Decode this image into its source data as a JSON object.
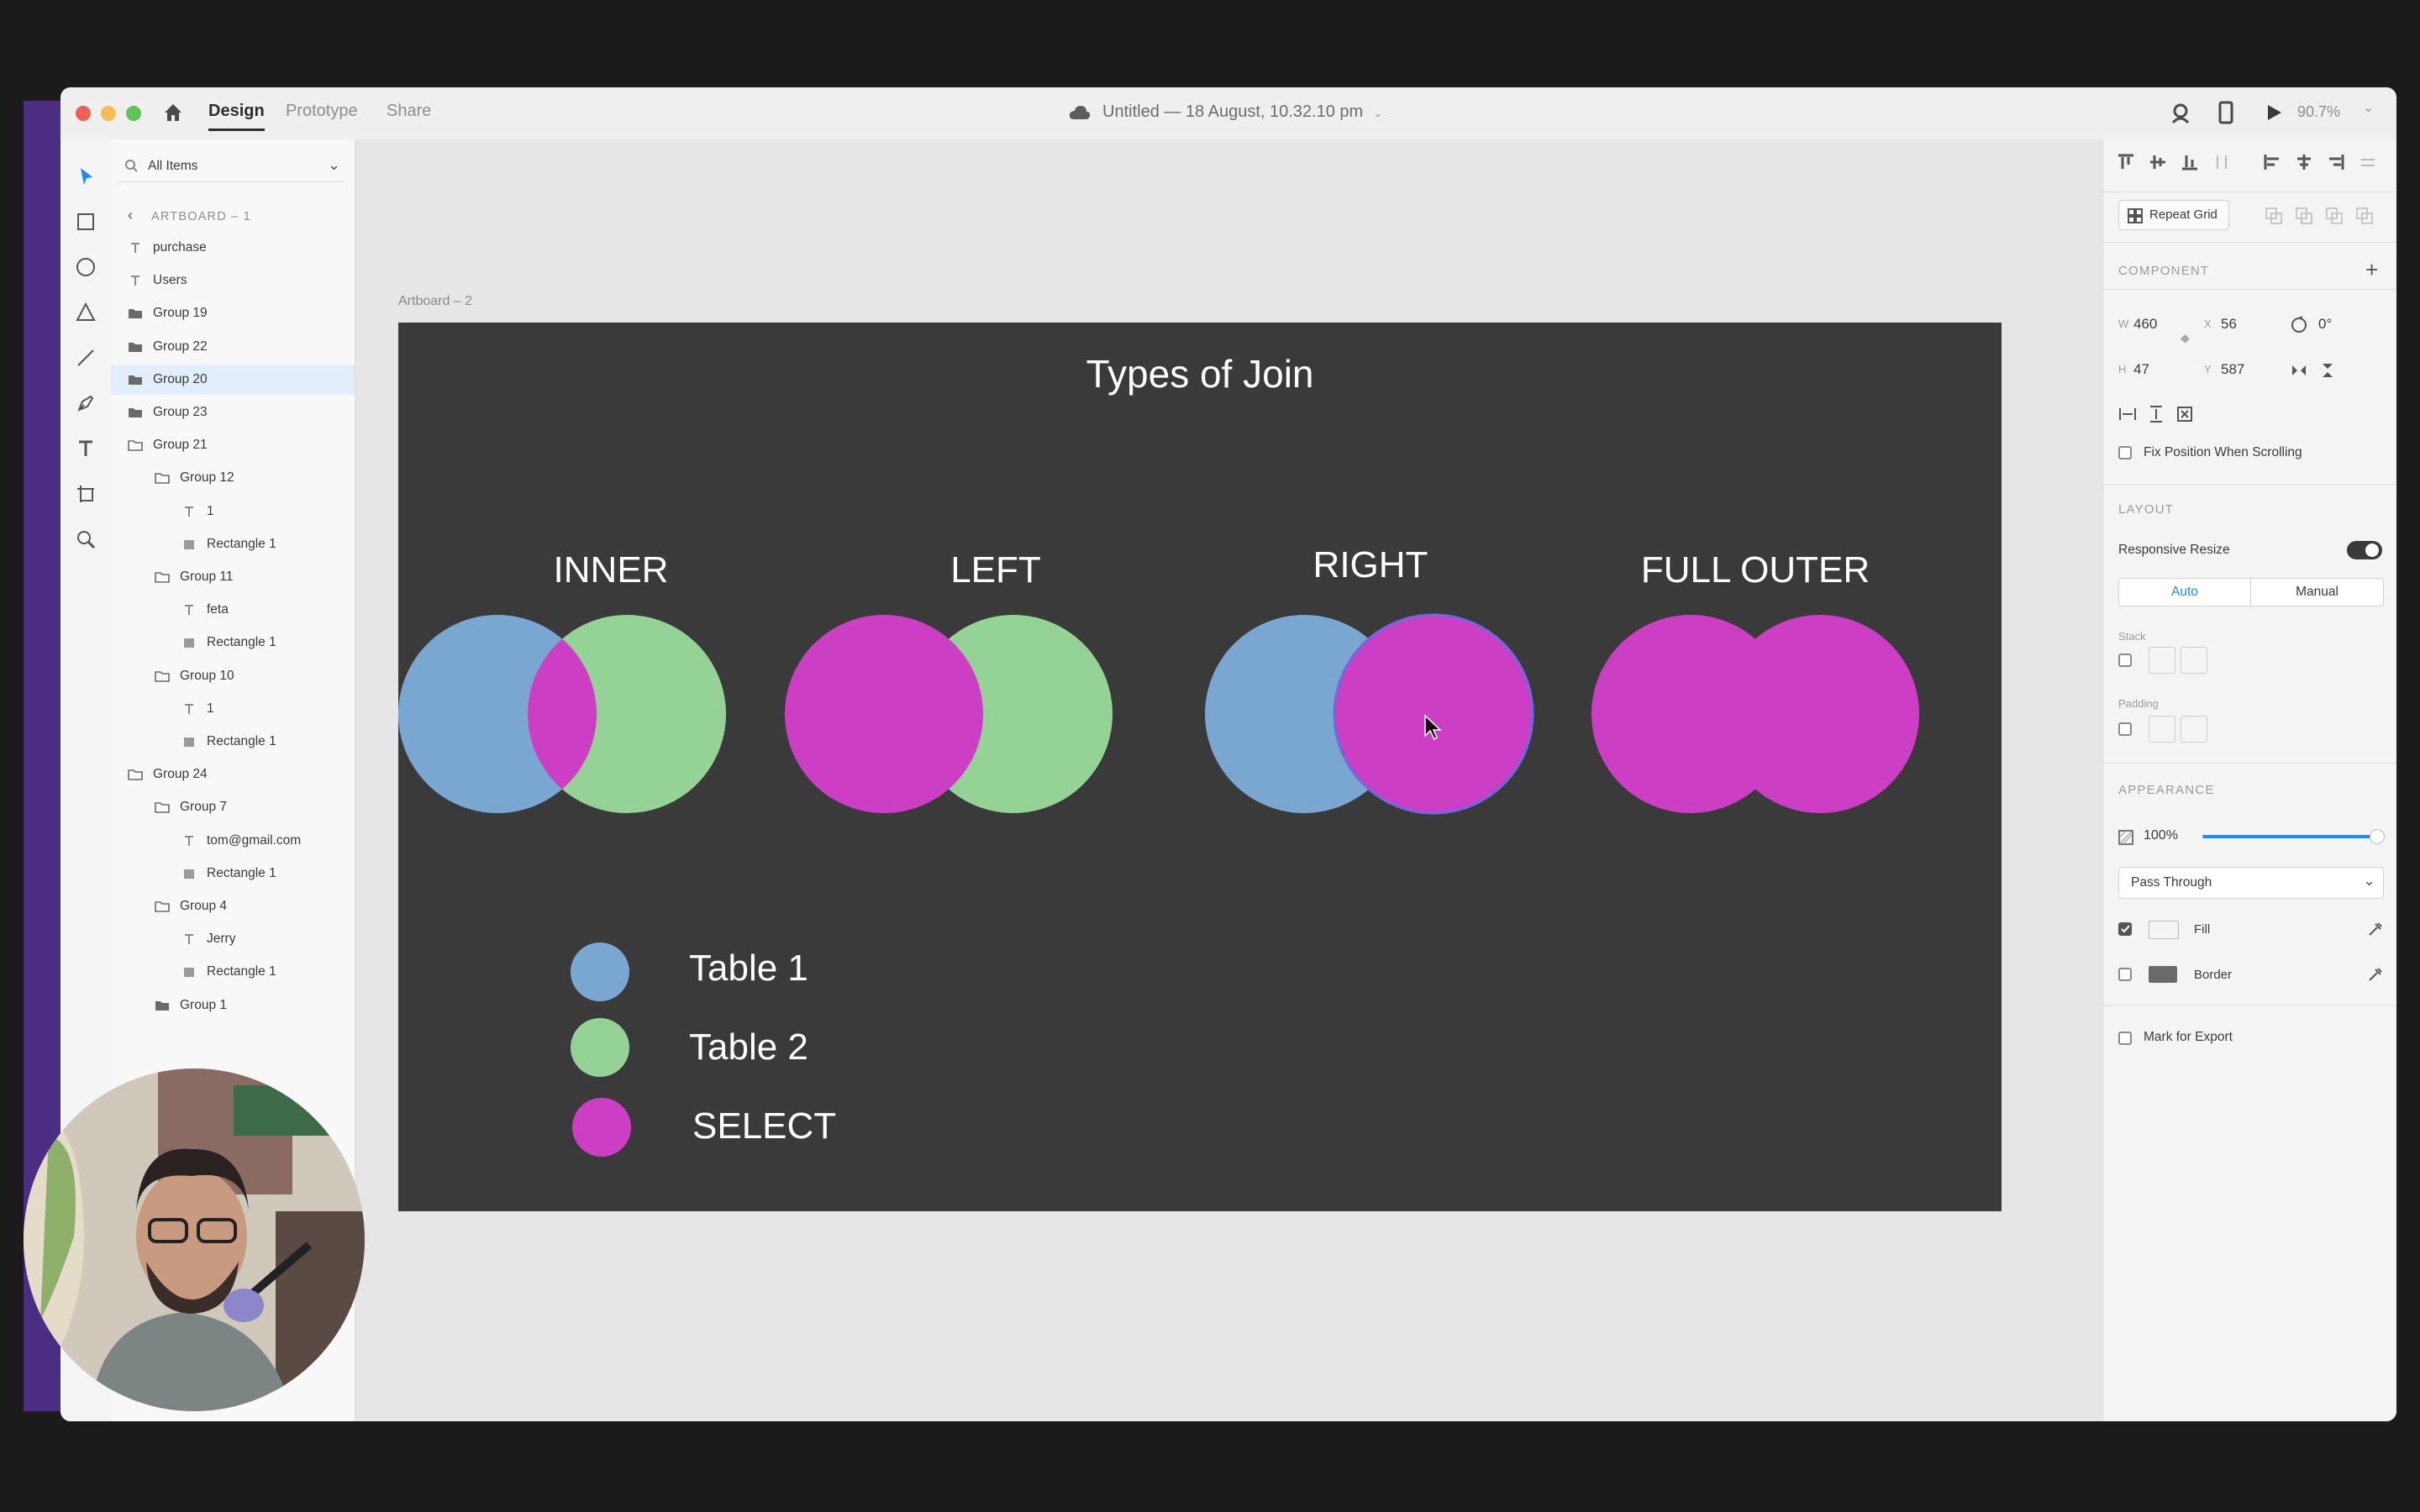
{
  "titlebar": {
    "tabs": [
      "Design",
      "Prototype",
      "Share"
    ],
    "active_tab": "Design",
    "doc_title": "Untitled — 18 August, 10.32.10 pm",
    "zoom": "90.7%"
  },
  "layers": {
    "filter": "All Items",
    "breadcrumb": "ARTBOARD – 1",
    "items": [
      {
        "label": "purchase",
        "icon": "text-icon",
        "indent": 0,
        "selected": false
      },
      {
        "label": "Users",
        "icon": "text-icon",
        "indent": 0,
        "selected": false
      },
      {
        "label": "Group 19",
        "icon": "folder-filled-icon",
        "indent": 0,
        "selected": false
      },
      {
        "label": "Group 22",
        "icon": "folder-filled-icon",
        "indent": 0,
        "selected": false
      },
      {
        "label": "Group 20",
        "icon": "folder-filled-icon",
        "indent": 0,
        "selected": true
      },
      {
        "label": "Group 23",
        "icon": "folder-filled-icon",
        "indent": 0,
        "selected": false
      },
      {
        "label": "Group 21",
        "icon": "folder-open-icon",
        "indent": 0,
        "selected": false
      },
      {
        "label": "Group 12",
        "icon": "folder-open-icon",
        "indent": 1,
        "selected": false
      },
      {
        "label": "1",
        "icon": "text-icon",
        "indent": 2,
        "selected": false
      },
      {
        "label": "Rectangle 1",
        "icon": "rectangle-icon",
        "indent": 2,
        "selected": false
      },
      {
        "label": "Group 11",
        "icon": "folder-open-icon",
        "indent": 1,
        "selected": false
      },
      {
        "label": "feta",
        "icon": "text-icon",
        "indent": 2,
        "selected": false
      },
      {
        "label": "Rectangle 1",
        "icon": "rectangle-icon",
        "indent": 2,
        "selected": false
      },
      {
        "label": "Group 10",
        "icon": "folder-open-icon",
        "indent": 1,
        "selected": false
      },
      {
        "label": "1",
        "icon": "text-icon",
        "indent": 2,
        "selected": false
      },
      {
        "label": "Rectangle 1",
        "icon": "rectangle-icon",
        "indent": 2,
        "selected": false
      },
      {
        "label": "Group 24",
        "icon": "folder-open-icon",
        "indent": 0,
        "selected": false
      },
      {
        "label": "Group 7",
        "icon": "folder-open-icon",
        "indent": 1,
        "selected": false
      },
      {
        "label": "tom@gmail.com",
        "icon": "text-icon",
        "indent": 2,
        "selected": false
      },
      {
        "label": "Rectangle 1",
        "icon": "rectangle-icon",
        "indent": 2,
        "selected": false
      },
      {
        "label": "Group 4",
        "icon": "folder-open-icon",
        "indent": 1,
        "selected": false
      },
      {
        "label": "Jerry",
        "icon": "text-icon",
        "indent": 2,
        "selected": false
      },
      {
        "label": "Rectangle 1",
        "icon": "rectangle-icon",
        "indent": 2,
        "selected": false
      },
      {
        "label": "Group 1",
        "icon": "folder-filled-icon",
        "indent": 1,
        "selected": false
      }
    ]
  },
  "canvas": {
    "artboard_label": "Artboard – 2",
    "title": "Types of Join",
    "joins": [
      "INNER",
      "LEFT",
      "RIGHT",
      "FULL OUTER"
    ],
    "legend": [
      "Table 1",
      "Table 2",
      "SELECT"
    ],
    "colors": {
      "table1": "#7aa7d1",
      "table2": "#94d296",
      "select": "#cc3fc4",
      "artboard": "#3a3a3a"
    }
  },
  "properties": {
    "repeat_grid": "Repeat Grid",
    "component_label": "COMPONENT",
    "w_label": "W",
    "w": "460",
    "x_label": "X",
    "x": "56",
    "rotation": "0°",
    "h_label": "H",
    "h": "47",
    "y_label": "Y",
    "y": "587",
    "fix_position": "Fix Position When Scrolling",
    "layout_label": "LAYOUT",
    "responsive_resize": "Responsive Resize",
    "responsive_on": true,
    "auto": "Auto",
    "manual": "Manual",
    "stack": "Stack",
    "padding": "Padding",
    "appearance_label": "APPEARANCE",
    "opacity": "100%",
    "opacity_value": 1.0,
    "blend_mode": "Pass Through",
    "fill": "Fill",
    "border": "Border",
    "mark_export": "Mark for Export"
  }
}
